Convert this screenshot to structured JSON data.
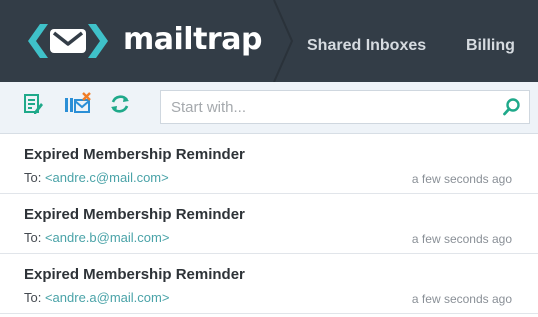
{
  "header": {
    "brand": "mailtrap",
    "nav": [
      {
        "label": "Shared Inboxes"
      },
      {
        "label": "Billing"
      }
    ]
  },
  "toolbar": {
    "search_placeholder": "Start with...",
    "search_value": ""
  },
  "messages": [
    {
      "subject": "Expired Membership Reminder",
      "to_prefix": "To: ",
      "email": "<andre.c@mail.com>",
      "time": "a few seconds ago"
    },
    {
      "subject": "Expired Membership Reminder",
      "to_prefix": "To: ",
      "email": "<andre.b@mail.com>",
      "time": "a few seconds ago"
    },
    {
      "subject": "Expired Membership Reminder",
      "to_prefix": "To: ",
      "email": "<andre.a@mail.com>",
      "time": "a few seconds ago"
    }
  ],
  "colors": {
    "header_bg": "#333d47",
    "logo_teal": "#3fc1c9",
    "toolbar_bg": "#eef3f8",
    "icon_green": "#1fa98a",
    "icon_blue": "#2b8fd6",
    "icon_orange": "#f07d26",
    "link_teal": "#4aa3a8"
  },
  "icons": [
    "mailtrap-logo-icon",
    "edit-icon",
    "clean-inbox-icon",
    "refresh-icon",
    "search-icon"
  ]
}
